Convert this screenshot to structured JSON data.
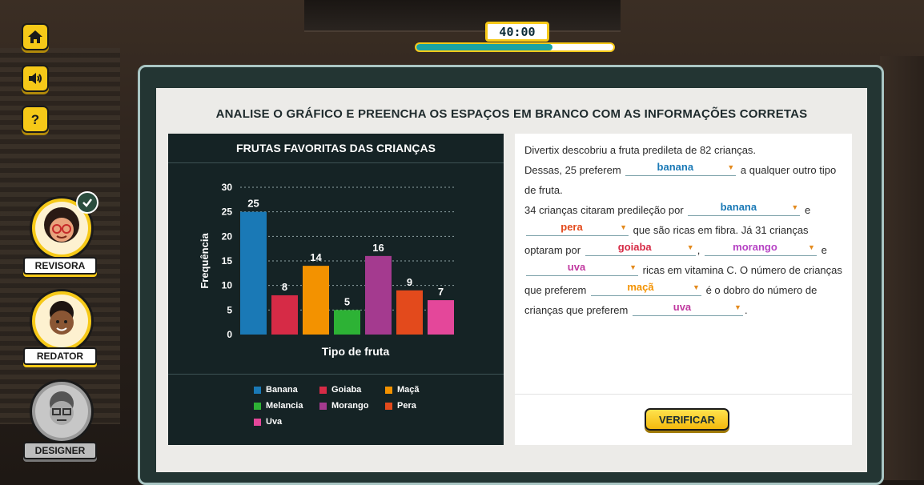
{
  "timer": {
    "text": "40:00",
    "progress": 0.69
  },
  "nav": [
    {
      "name": "home-button",
      "icon": "home-icon"
    },
    {
      "name": "sound-button",
      "icon": "speaker-icon"
    },
    {
      "name": "help-button",
      "icon": "question-icon"
    }
  ],
  "roles": [
    {
      "label": "REVISORA",
      "state": "completed"
    },
    {
      "label": "REDATOR",
      "state": "active"
    },
    {
      "label": "DESIGNER",
      "state": "inactive"
    }
  ],
  "instruction": "ANALISE O GRÁFICO E PREENCHA OS ESPAÇOS EM BRANCO COM AS INFORMAÇÕES CORRETAS",
  "chart_data": {
    "type": "bar",
    "title": "FRUTAS FAVORITAS DAS CRIANÇAS",
    "xlabel": "Tipo de fruta",
    "ylabel": "Frequência",
    "ylim": [
      0,
      30
    ],
    "yticks": [
      "0",
      "5",
      "10",
      "15",
      "20",
      "25",
      "30"
    ],
    "grid": true,
    "categories": [
      "Banana",
      "Goiaba",
      "Maçã",
      "Melancia",
      "Morango",
      "Pera",
      "Uva"
    ],
    "values": [
      25,
      8,
      14,
      5,
      16,
      9,
      7
    ],
    "colors": [
      "#1a79b6",
      "#d62b46",
      "#f39200",
      "#2db235",
      "#a43a8f",
      "#e34a1c",
      "#e4479a"
    ],
    "legend_position": "bottom"
  },
  "text": {
    "p1": "Divertix descobriu a fruta predileta de 82 crianças.",
    "p2a": "Dessas, 25 preferem",
    "p2b": "a qualquer outro tipo de fruta.",
    "p3a": "34 crianças citaram predileção por",
    "p3b": "e",
    "p4": "que são ricas em fibra.  Já 31 crianças optaram por",
    "p5": ",",
    "p6": "e",
    "p7": "ricas em vitamina C.  O número de crianças  que preferem",
    "p8": "é o dobro do número de crianças que preferem",
    "p9": "."
  },
  "blanks": [
    {
      "value": "banana",
      "color": "#1a79b6"
    },
    {
      "value": "banana",
      "color": "#1a79b6"
    },
    {
      "value": "pera",
      "color": "#e34a1c"
    },
    {
      "value": "goiaba",
      "color": "#d62b46"
    },
    {
      "value": "morango",
      "color": "#b643c4"
    },
    {
      "value": "uva",
      "color": "#c13aa0"
    },
    {
      "value": "maçã",
      "color": "#f39200"
    },
    {
      "value": "uva",
      "color": "#c13aa0"
    }
  ],
  "verify_label": "VERIFICAR"
}
